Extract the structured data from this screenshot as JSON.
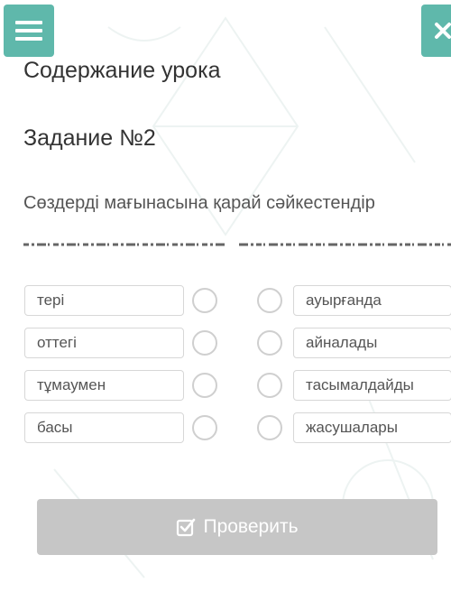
{
  "header": {
    "menu_icon": "hamburger-icon",
    "close_icon": "close-icon",
    "accent_color": "#5fb8ab"
  },
  "lesson": {
    "title": "Содержание урока",
    "task_title": "Задание №2",
    "instruction": "Сөздерді мағынасына қарай сәйкестендір"
  },
  "left_items": [
    "тері",
    "оттегі",
    "тұмаумен",
    "басы"
  ],
  "right_items": [
    "ауырғанда",
    "айналады",
    "тасымалдайды",
    "жасушалары"
  ],
  "check_button": {
    "label": "Проверить",
    "icon": "check-square-icon",
    "color": "#c6c6c6"
  }
}
